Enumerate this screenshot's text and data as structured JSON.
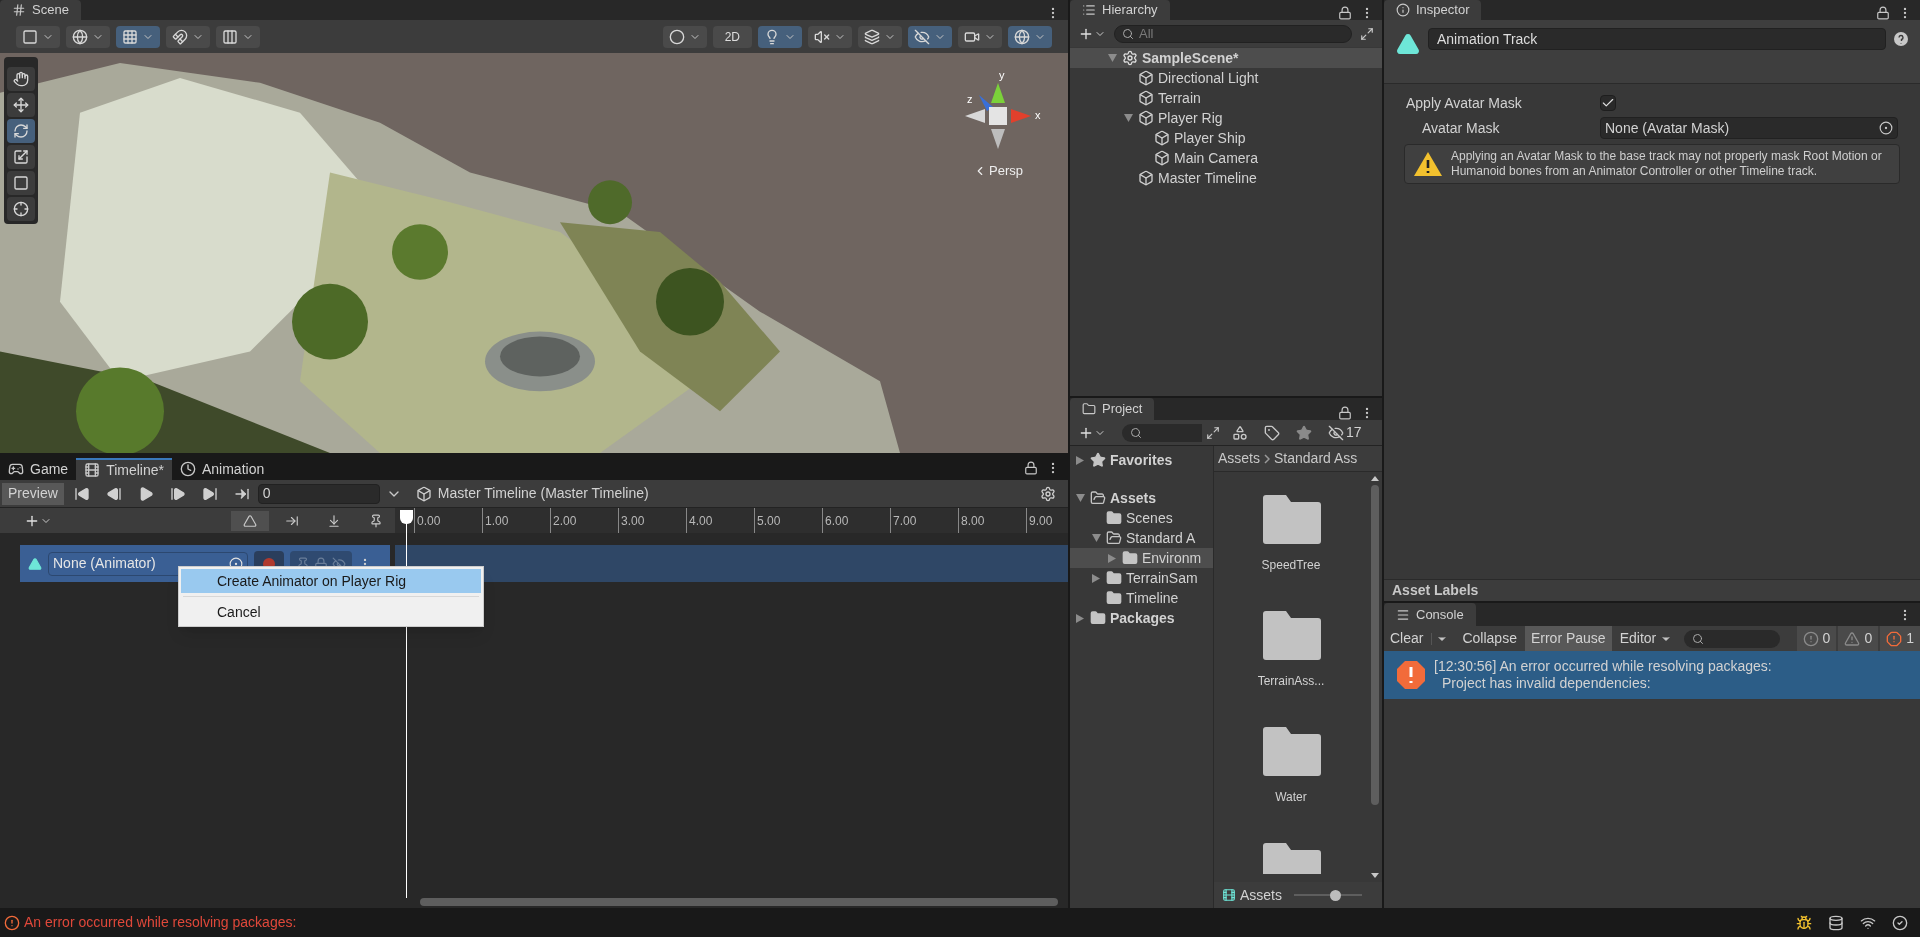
{
  "scene": {
    "tab": "Scene",
    "toolbar_left": [
      {
        "kind": "draw-mode",
        "selected": false
      },
      {
        "kind": "global",
        "selected": false
      },
      {
        "kind": "grid-snap",
        "selected": true
      },
      {
        "kind": "snap-increment",
        "selected": false
      },
      {
        "kind": "grid",
        "selected": false
      }
    ],
    "toolbar_right": [
      {
        "kind": "render",
        "selected": false
      },
      {
        "kind": "mode-2d",
        "label": "2D",
        "selected": false
      },
      {
        "kind": "lighting",
        "selected": true
      },
      {
        "kind": "audio",
        "selected": false
      },
      {
        "kind": "effects",
        "selected": false
      },
      {
        "kind": "visibility",
        "selected": true
      },
      {
        "kind": "camera",
        "selected": false
      },
      {
        "kind": "gizmos",
        "selected": true
      }
    ],
    "tools": [
      {
        "kind": "hand",
        "selected": false
      },
      {
        "kind": "move",
        "selected": false
      },
      {
        "kind": "rotate",
        "selected": true
      },
      {
        "kind": "scale",
        "selected": false
      },
      {
        "kind": "rect",
        "selected": false
      },
      {
        "kind": "transform",
        "selected": false
      }
    ],
    "gizmo": {
      "axis_y": "y",
      "axis_z": "z",
      "axis_x": "x",
      "projection": "Persp"
    }
  },
  "timeline": {
    "tabs": [
      {
        "kind": "game",
        "label": "Game",
        "selected": false
      },
      {
        "kind": "timeline",
        "label": "Timeline*",
        "selected": true
      },
      {
        "kind": "animation",
        "label": "Animation",
        "selected": false
      }
    ],
    "preview": "Preview",
    "frame": "0",
    "asset": "Master Timeline (Master Timeline)",
    "ruler": [
      "0.00",
      "1.00",
      "2.00",
      "3.00",
      "4.00",
      "5.00",
      "6.00",
      "7.00",
      "8.00",
      "9.00"
    ],
    "track": {
      "binding": "None (Animator)",
      "selected": true
    },
    "menu": [
      {
        "label": "Create Animator on Player Rig",
        "selected": true
      },
      {
        "label": "Cancel",
        "selected": false
      }
    ]
  },
  "hierarchy": {
    "title": "Hierarchy",
    "search_placeholder": "All",
    "tree": [
      {
        "label": "SampleScene*",
        "kind": "scene",
        "selected": true,
        "expanded": true,
        "children": [
          {
            "label": "Directional Light",
            "kind": "object",
            "selected": false
          },
          {
            "label": "Terrain",
            "kind": "object",
            "selected": false
          },
          {
            "label": "Player Rig",
            "kind": "object",
            "selected": false,
            "expanded": true,
            "children": [
              {
                "label": "Player Ship",
                "kind": "object",
                "selected": false
              },
              {
                "label": "Main Camera",
                "kind": "object",
                "selected": false
              }
            ]
          },
          {
            "label": "Master Timeline",
            "kind": "object",
            "selected": false
          }
        ]
      }
    ]
  },
  "project": {
    "title": "Project",
    "hidden_count": "17",
    "tree": [
      {
        "label": "Favorites",
        "kind": "favorites",
        "selected": false,
        "expanded": false
      },
      {
        "label": "Assets",
        "kind": "root",
        "selected": false,
        "expanded": true,
        "children": [
          {
            "label": "Scenes",
            "kind": "folder",
            "selected": false
          },
          {
            "label": "Standard A",
            "kind": "folder",
            "selected": false,
            "expanded": true,
            "children": [
              {
                "label": "Environm",
                "kind": "folder",
                "selected": true,
                "expanded": false
              }
            ]
          },
          {
            "label": "TerrainSam",
            "kind": "folder",
            "selected": false,
            "expanded": false
          },
          {
            "label": "Timeline",
            "kind": "folder",
            "selected": false
          }
        ]
      },
      {
        "label": "Packages",
        "kind": "root",
        "selected": false,
        "expanded": false
      }
    ],
    "breadcrumb": [
      "Assets",
      "Standard Ass"
    ],
    "items": [
      {
        "kind": "folder",
        "name": "SpeedTree"
      },
      {
        "kind": "folder",
        "name": "TerrainAss..."
      },
      {
        "kind": "folder",
        "name": "Water"
      },
      {
        "kind": "folder"
      }
    ],
    "footer": "Assets",
    "zoom": {
      "level": 0.6
    }
  },
  "inspector": {
    "title": "Inspector",
    "name": "Animation Track",
    "apply_mask": {
      "label": "Apply Avatar Mask",
      "checked": true
    },
    "avatar_mask": {
      "label": "Avatar Mask",
      "value": "None (Avatar Mask)"
    },
    "warning": "Applying an Avatar Mask to the base track may not properly mask Root Motion or Humanoid bones from an Animator Controller or other Timeline track.",
    "asset_labels": "Asset Labels"
  },
  "console": {
    "title": "Console",
    "buttons": [
      {
        "label": "Clear",
        "kind": "dropdown",
        "selected": false
      },
      {
        "label": "Collapse",
        "kind": "toggle",
        "selected": false
      },
      {
        "label": "Error Pause",
        "kind": "toggle",
        "selected": true
      },
      {
        "label": "Editor",
        "kind": "menu",
        "selected": false
      }
    ],
    "counts": [
      {
        "kind": "info",
        "count": "0"
      },
      {
        "kind": "warning",
        "count": "0"
      },
      {
        "kind": "error",
        "count": "1"
      }
    ],
    "entries": [
      {
        "kind": "error",
        "selected": true,
        "lines": [
          "[12:30:56] An error occurred while resolving packages:",
          "Project has invalid dependencies:"
        ]
      }
    ]
  },
  "status_bar": {
    "message": "An error occurred while resolving packages:"
  }
}
